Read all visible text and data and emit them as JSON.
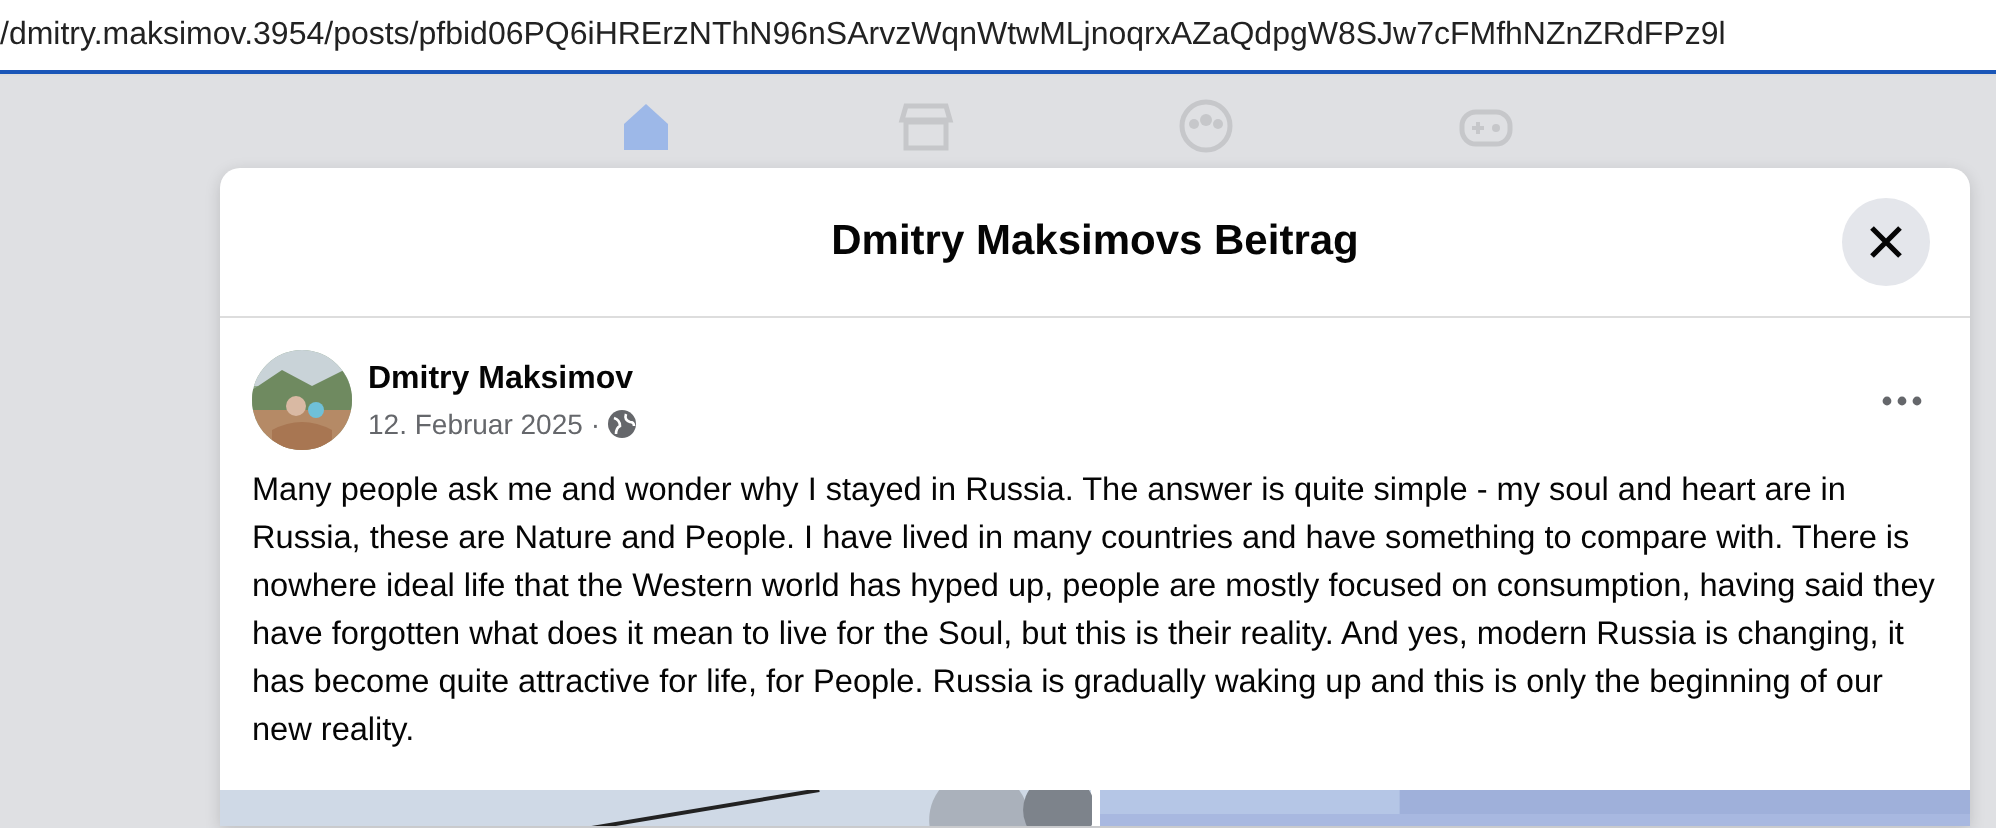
{
  "address_bar": {
    "url": "/dmitry.maksimov.3954/posts/pfbid06PQ6iHRErzNThN96nSArvzWqnWtwMLjnoqrxAZaQdpgW8SJw7cFMfhNZnZRdFPz9l"
  },
  "nav": [
    {
      "kind": "home",
      "selected": true
    },
    {
      "kind": "marketplace",
      "selected": false
    },
    {
      "kind": "groups",
      "selected": false
    },
    {
      "kind": "gaming",
      "selected": false
    }
  ],
  "dialog": {
    "title": "Dmitry Maksimovs Beitrag",
    "post": {
      "author": "Dmitry Maksimov",
      "date": "12. Februar 2025",
      "separator": "·",
      "text": "Many people ask me and wonder why I stayed in Russia. The answer is quite simple - my soul and heart are in Russia, these are Nature and People. I have lived in many countries and have something to compare with. There is nowhere ideal life that the Western world has hyped up, people are mostly focused on consumption, having said they have forgotten what does it mean to live for the Soul, but this is their reality. And yes, modern Russia is changing, it has become quite attractive for life, for People. Russia is gradually waking up and this is only the beginning of our new reality."
    }
  }
}
